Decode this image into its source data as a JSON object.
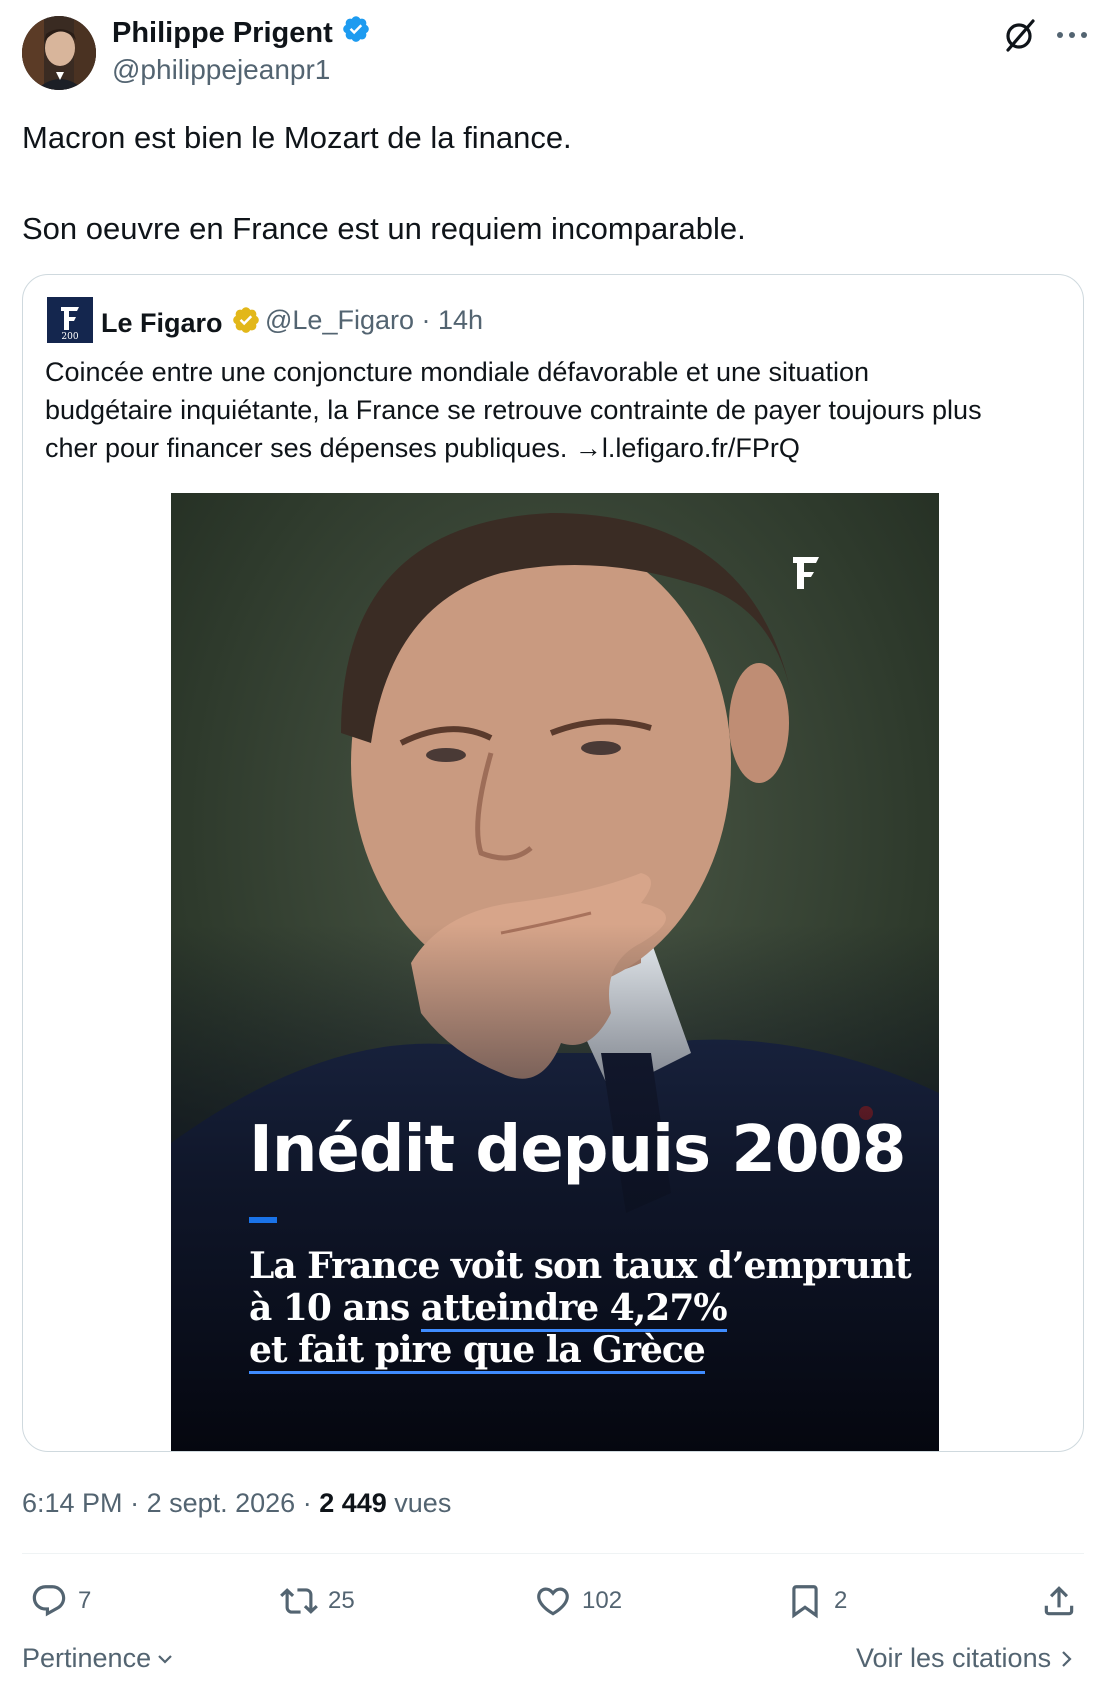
{
  "author": {
    "display_name": "Philippe Prigent",
    "handle": "@philippejeanpr1"
  },
  "tweet": {
    "line1": "Macron est bien le Mozart de la finance.",
    "line2": "Son oeuvre en France est un requiem incomparable."
  },
  "quoted": {
    "display_name": "Le Figaro",
    "handle_time": "@Le_Figaro · 14h",
    "text_lines": [
      "Coincée entre une conjoncture mondiale défavorable et une situation",
      "budgétaire inquiétante, la France se retrouve contrainte de payer toujours plus",
      "cher pour financer ses dépenses publiques. →l.lefigaro.fr/FPrQ"
    ],
    "media": {
      "headline": "Inédit depuis 2008",
      "sub_line1": "La France voit son taux d’emprunt",
      "sub_line2_prefix": "à 10 ans ",
      "sub_line2_underlined": "atteindre 4,27%",
      "sub_line3": "et fait pire que la Grèce"
    }
  },
  "meta": {
    "time": "6:14 PM",
    "date": "2 sept. 2026",
    "views_count": "2 449",
    "views_label": "vues"
  },
  "actions": {
    "replies": "7",
    "reposts": "25",
    "likes": "102",
    "bookmarks": "2"
  },
  "footer": {
    "sort_label": "Pertinence",
    "quotes_link": "Voir les citations"
  },
  "icons": {
    "verified_author": "verified-blue-badge-icon",
    "verified_quoted": "verified-gold-badge-icon",
    "grok": "grok-icon",
    "more": "more-icon",
    "reply": "reply-icon",
    "repost": "repost-icon",
    "like": "heart-icon",
    "bookmark": "bookmark-icon",
    "share": "share-icon"
  },
  "colors": {
    "verified_blue": "#1d9bf0",
    "verified_gold": "#e2b719",
    "muted_text": "#536471"
  }
}
